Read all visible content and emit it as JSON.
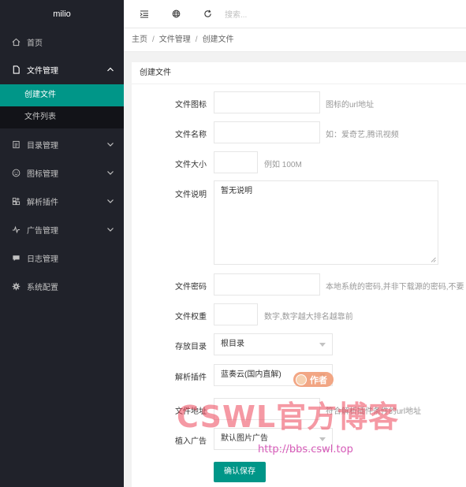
{
  "brand": "milio",
  "sidebar": {
    "items": [
      {
        "label": "首页"
      },
      {
        "label": "文件管理"
      },
      {
        "label": "目录管理"
      },
      {
        "label": "图标管理"
      },
      {
        "label": "解析插件"
      },
      {
        "label": "广告管理"
      },
      {
        "label": "日志管理"
      },
      {
        "label": "系统配置"
      }
    ],
    "submenu": [
      {
        "label": "创建文件"
      },
      {
        "label": "文件列表"
      }
    ]
  },
  "header": {
    "search_placeholder": "搜索..."
  },
  "breadcrumb": [
    "主页",
    "文件管理",
    "创建文件"
  ],
  "card": {
    "title": "创建文件"
  },
  "form": {
    "icon_label": "文件图标",
    "icon_tip": "图标的url地址",
    "name_label": "文件名称",
    "name_tip": "如：爱奇艺,腾讯视频",
    "size_label": "文件大小",
    "size_tip": "例如 100M",
    "desc_label": "文件说明",
    "desc_value": "暂无说明",
    "pwd_label": "文件密码",
    "pwd_tip": "本地系统的密码,并非下载源的密码,不要",
    "weight_label": "文件权重",
    "weight_tip": "数字,数字越大排名越靠前",
    "dir_label": "存放目录",
    "dir_value": "根目录",
    "plugin_label": "解析插件",
    "plugin_value": "蓝奏云(国内直解)",
    "url_label": "文件地址",
    "url_tip": "符合解析插件条件的url地址",
    "ad_label": "植入广告",
    "ad_value": "默认图片广告",
    "save_label": "确认保存"
  },
  "watermark": {
    "badge": "作者",
    "main": "CSWL官方博客",
    "url": "http://bbs.cswl.top"
  },
  "colors": {
    "sidebar_bg": "#20222a",
    "accent": "#009688",
    "submenu_bg": "#121318"
  }
}
